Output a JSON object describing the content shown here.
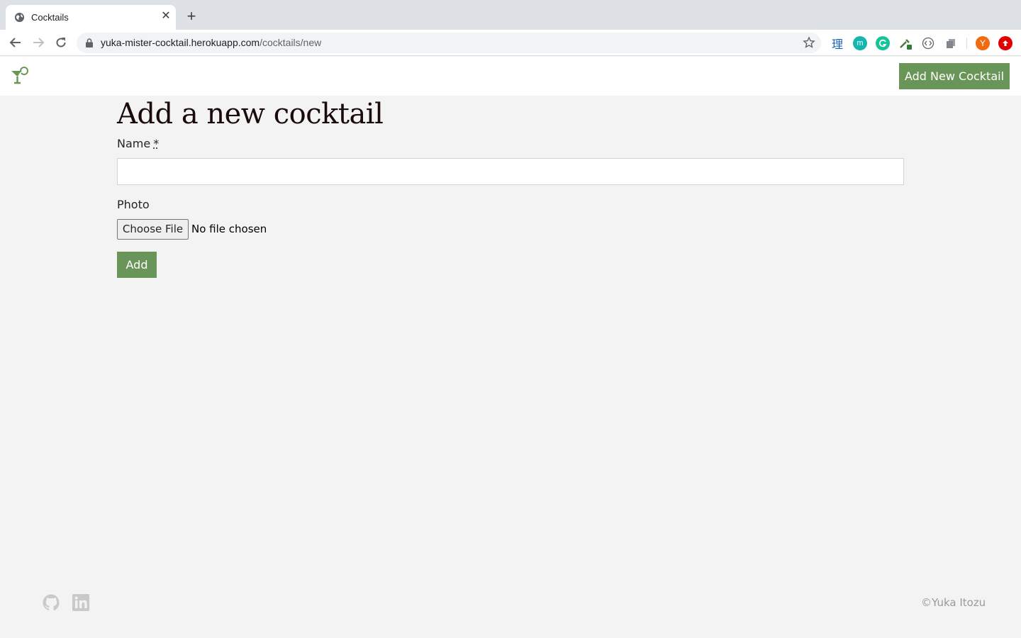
{
  "browser": {
    "tab_title": "Cocktails",
    "tab_close": "✕",
    "new_tab": "+",
    "url_host": "yuka-mister-cocktail.herokuapp.com",
    "url_path": "/cocktails/new",
    "profile_initial": "Y",
    "ext_m": "m",
    "ext_kanji": "理"
  },
  "navbar": {
    "add_new_label": "Add New Cocktail"
  },
  "form": {
    "heading": "Add a new cocktail",
    "name_label": "Name",
    "required_mark": "*",
    "name_value": "",
    "photo_label": "Photo",
    "choose_file_label": "Choose File",
    "file_status": "No file chosen",
    "submit_label": "Add"
  },
  "footer": {
    "copyright": "©Yuka Itozu"
  },
  "colors": {
    "accent": "#6a9559",
    "page_bg": "#f3f3f3"
  }
}
